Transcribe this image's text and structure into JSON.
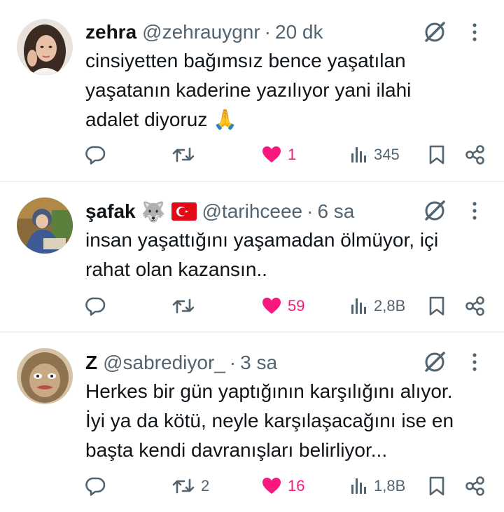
{
  "posts": [
    {
      "name": "zehra",
      "handle": "@zehrauygnr",
      "separator": "·",
      "time": "20 dk",
      "text_lines": [
        "cinsiyetten bağımsız bence yaşatılan",
        "yaşatanın kaderine yazılıyor yani ilahi",
        "adalet diyoruz 🙏"
      ],
      "replies": "",
      "reposts": "",
      "likes": "1",
      "views": "345",
      "liked": true
    },
    {
      "name": "şafak",
      "name_emoji": "🐺",
      "handle": "@tarihceee",
      "separator": "·",
      "time": "6 sa",
      "text_lines": [
        "insan yaşattığını yaşamadan ölmüyor, içi",
        "rahat olan kazansın.."
      ],
      "replies": "",
      "reposts": "",
      "likes": "59",
      "views": "2,8B",
      "liked": true
    },
    {
      "name": "Z",
      "handle": "@sabrediyor_",
      "separator": "·",
      "time": "3 sa",
      "text_lines": [
        "Herkes bir gün yaptığının karşılığını alıyor.",
        "İyi ya da kötü, neyle karşılaşacağını ise en",
        "başta kendi davranışları belirliyor..."
      ],
      "replies": "",
      "reposts": "2",
      "likes": "16",
      "views": "1,8B",
      "liked": true
    }
  ],
  "colors": {
    "text": "#0f1419",
    "secondary": "#536471",
    "like": "#f91880",
    "divider": "#eff3f4"
  },
  "icons": [
    "reply-icon",
    "repost-icon",
    "heart-icon",
    "views-icon",
    "bookmark-icon",
    "share-icon",
    "grok-icon",
    "more-icon",
    "turkish-flag-icon"
  ]
}
